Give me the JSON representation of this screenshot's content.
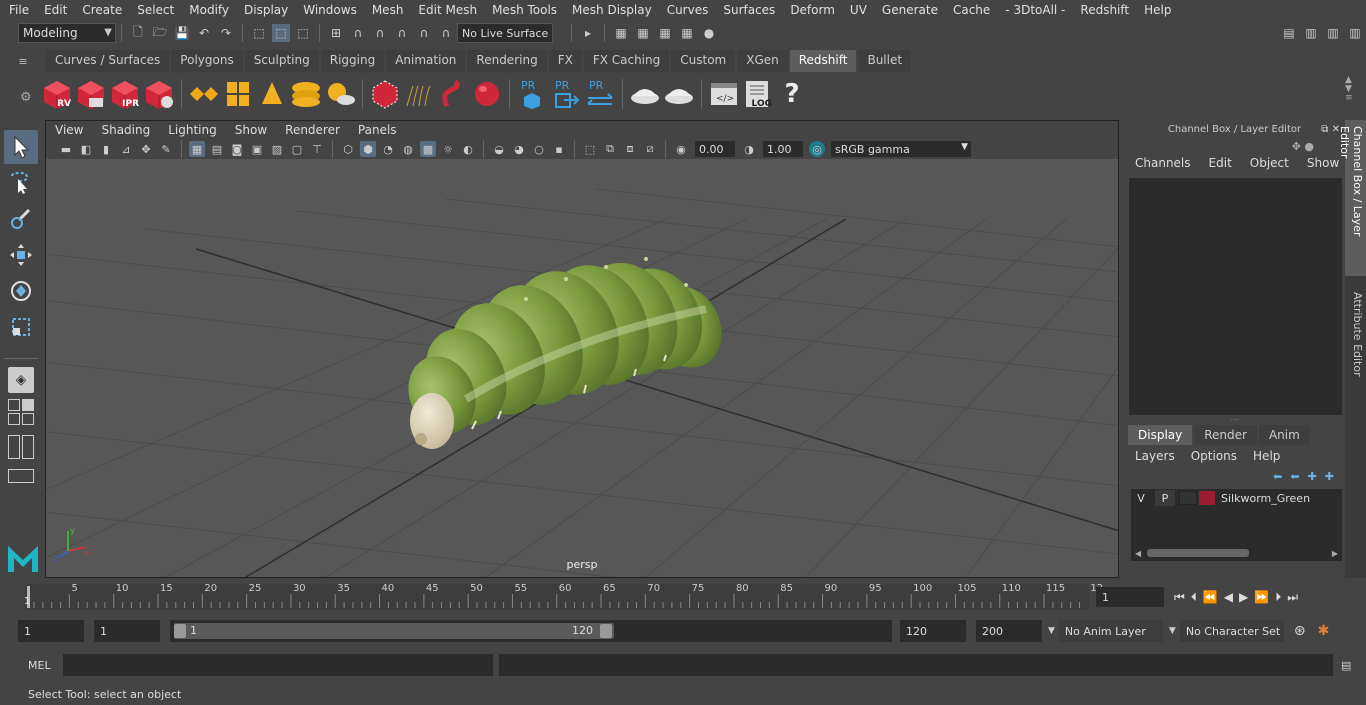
{
  "menubar": {
    "items": [
      "File",
      "Edit",
      "Create",
      "Select",
      "Modify",
      "Display",
      "Windows",
      "Mesh",
      "Edit Mesh",
      "Mesh Tools",
      "Mesh Display",
      "Curves",
      "Surfaces",
      "Deform",
      "UV",
      "Generate",
      "Cache",
      "- 3DtoAll -",
      "Redshift",
      "Help"
    ]
  },
  "statusline": {
    "mode": "Modeling",
    "live_surface": "No Live Surface"
  },
  "shelf": {
    "tabs": [
      "Curves / Surfaces",
      "Polygons",
      "Sculpting",
      "Rigging",
      "Animation",
      "Rendering",
      "FX",
      "FX Caching",
      "Custom",
      "XGen",
      "Redshift",
      "Bullet"
    ],
    "active_tab": "Redshift",
    "icon_labels": {
      "rv": "RV",
      "ipr": "IPR",
      "pr": "PR",
      "log": "LOG",
      "help": "?"
    }
  },
  "viewport": {
    "menus": [
      "View",
      "Shading",
      "Lighting",
      "Show",
      "Renderer",
      "Panels"
    ],
    "exposure": "0.00",
    "gamma": "1.00",
    "color_space": "sRGB gamma",
    "camera_label": "persp"
  },
  "channel_box": {
    "title": "Channel Box / Layer Editor",
    "menus": [
      "Channels",
      "Edit",
      "Object",
      "Show"
    ]
  },
  "layer_editor": {
    "tabs": [
      "Display",
      "Render",
      "Anim"
    ],
    "active_tab": "Display",
    "menus": [
      "Layers",
      "Options",
      "Help"
    ],
    "layers": [
      {
        "v": "V",
        "p": "P",
        "color": "#9b1b30",
        "name": "Silkworm_Green"
      }
    ]
  },
  "side_tabs": [
    "Channel Box / Layer Editor",
    "Attribute Editor"
  ],
  "timeslider": {
    "ticks": [
      "5",
      "10",
      "15",
      "20",
      "25",
      "30",
      "35",
      "40",
      "45",
      "50",
      "55",
      "60",
      "65",
      "70",
      "75",
      "80",
      "85",
      "90",
      "95",
      "100",
      "105",
      "110",
      "115",
      "12"
    ],
    "start_label": "1",
    "current_frame": "1"
  },
  "range": {
    "start_a": "1",
    "start_b": "1",
    "slider_start": "1",
    "slider_end": "120",
    "end_a": "120",
    "end_b": "200",
    "anim_layer": "No Anim Layer",
    "character_set": "No Character Set"
  },
  "mel": {
    "label": "MEL"
  },
  "helpline": {
    "text": "Select Tool: select an object"
  }
}
